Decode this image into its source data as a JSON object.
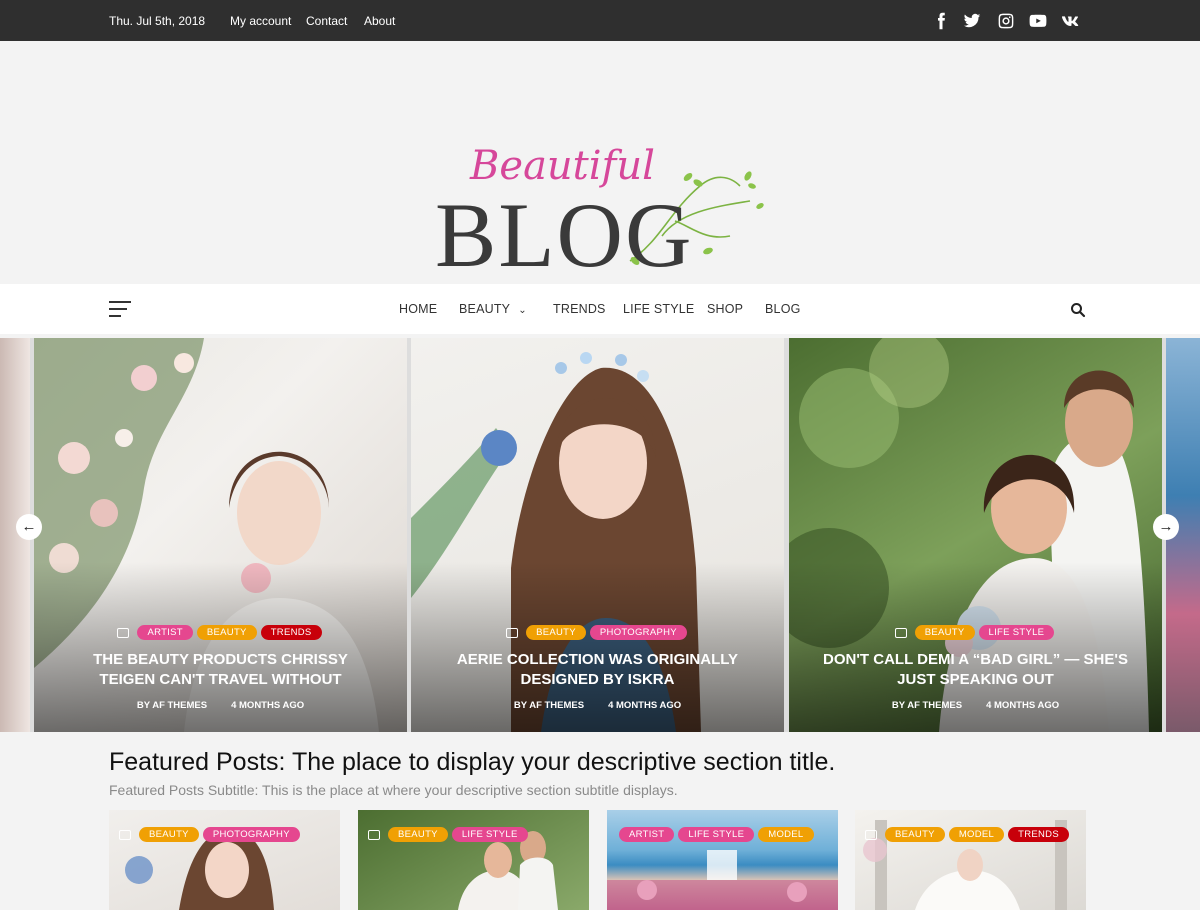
{
  "topbar": {
    "date": "Thu. Jul 5th, 2018",
    "links": [
      "My account",
      "Contact",
      "About"
    ],
    "social_icons": [
      "facebook-icon",
      "twitter-icon",
      "instagram-icon",
      "youtube-icon",
      "vk-icon"
    ]
  },
  "logo": {
    "script_text": "Beautiful",
    "main_text": "BLOG"
  },
  "nav": {
    "items": [
      "HOME",
      "BEAUTY",
      "TRENDS",
      "LIFE STYLE",
      "SHOP",
      "BLOG"
    ],
    "menu_icon": "hamburger-icon",
    "search_icon": "search-icon"
  },
  "slides": [
    {
      "categories": [
        "ARTIST",
        "BEAUTY",
        "TRENDS"
      ],
      "title_line1": "THE BEAUTY PRODUCTS CHRISSY",
      "title_line2": "TEIGEN CAN'T TRAVEL WITHOUT",
      "author": "BY AF THEMES",
      "time": "4 MONTHS AGO"
    },
    {
      "categories": [
        "BEAUTY",
        "PHOTOGRAPHY"
      ],
      "title_line1": "AERIE COLLECTION WAS ORIGINALLY",
      "title_line2": "DESIGNED BY ISKRA",
      "author": "BY AF THEMES",
      "time": "4 MONTHS AGO"
    },
    {
      "categories": [
        "BEAUTY",
        "LIFE STYLE"
      ],
      "title_line1": "DON'T CALL DEMI A “BAD GIRL” — SHE'S",
      "title_line2": "JUST SPEAKING OUT",
      "author": "BY AF THEMES",
      "time": "4 MONTHS AGO"
    }
  ],
  "slider_arrows": {
    "prev": "←",
    "next": "→"
  },
  "featured": {
    "title": "Featured Posts: The place to display your descriptive section title.",
    "subtitle": "Featured Posts Subtitle: This is the place at where your descriptive section subtitle displays.",
    "cards": [
      {
        "categories": [
          "BEAUTY",
          "PHOTOGRAPHY"
        ]
      },
      {
        "categories": [
          "BEAUTY",
          "LIFE STYLE"
        ]
      },
      {
        "categories": [
          "ARTIST",
          "LIFE STYLE",
          "MODEL"
        ]
      },
      {
        "categories": [
          "BEAUTY",
          "MODEL",
          "TRENDS"
        ]
      }
    ]
  },
  "colors": {
    "topbar_bg": "#2f2f2f",
    "tag_pink": "#e5478f",
    "tag_orange": "#f0a004",
    "tag_red": "#c8000a"
  }
}
